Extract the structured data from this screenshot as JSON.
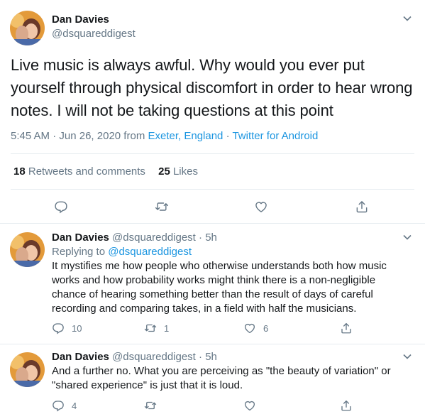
{
  "main_tweet": {
    "author_name": "Dan Davies",
    "author_handle": "@dsquareddigest",
    "text": "Live music is always awful. Why would you ever put yourself through physical discomfort in order to hear wrong notes. I will not be taking questions at this point",
    "time": "5:45 AM",
    "sep1": " · ",
    "date": "Jun 26, 2020",
    "from_label": " from ",
    "location": "Exeter, England",
    "sep2": " · ",
    "source": "Twitter for Android",
    "retweets_count": "18",
    "retweets_label": " Retweets and comments",
    "likes_count": "25",
    "likes_label": " Likes",
    "icons": [
      "reply-icon",
      "retweet-icon",
      "like-icon",
      "share-icon"
    ]
  },
  "replies": [
    {
      "author_name": "Dan Davies",
      "author_handle": "@dsquareddigest",
      "age": " · 5h",
      "replying_label": "Replying to ",
      "replying_handle": "@dsquareddigest",
      "text": "It mystifies me how people who otherwise understands both how music works and how probability works might think there is a non-negligible chance of hearing something better than the result of days of careful recording and comparing takes, in a field with half the musicians.",
      "reply_count": "10",
      "retweet_count": "1",
      "like_count": "6"
    },
    {
      "author_name": "Dan Davies",
      "author_handle": "@dsquareddigest",
      "age": " · 5h",
      "text": "And a further no. What you are perceiving as \"the beauty of variation\" or \"shared experience\" is just that it is loud.",
      "reply_count": "4",
      "retweet_count": "",
      "like_count": ""
    }
  ],
  "colors": {
    "link": "#1b95e0",
    "muted": "#657786",
    "divider": "#e6ecf0",
    "reply_bg": "#f5f8fa",
    "text": "#14171a"
  }
}
